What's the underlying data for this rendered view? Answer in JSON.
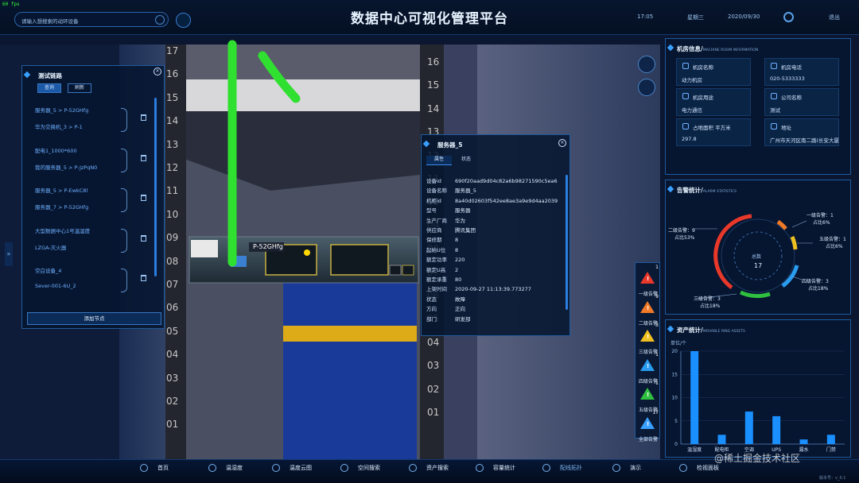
{
  "fps": "60 fps",
  "header": {
    "search_placeholder": "请输入想搜索的动环设备",
    "title": "数据中心可视化管理平台",
    "time": "17:05",
    "weekday": "星期三",
    "date": "2020/09/30",
    "exit": "退出"
  },
  "test_panel": {
    "title": "测试链路",
    "tab_query": "查询",
    "tab_refresh": "刷新",
    "groups": [
      {
        "a": "服务器_5 > P-52GHfg",
        "b": "华为交换机_3 > P-1"
      },
      {
        "a": "配电1_1000*600",
        "b": "我的服务器_5 > P-JzPqN0"
      },
      {
        "a": "服务器_5 > P-EwkC8l",
        "b": "服务器_7 > P-52GHfg"
      },
      {
        "a": "大型数据中心1号温湿度",
        "b": "LZGA-灭火器"
      },
      {
        "a": "空白设备_4",
        "b": "Sever-001-6U_2"
      }
    ],
    "add_button": "添加节点"
  },
  "rack": {
    "left_units": [
      "17",
      "16",
      "15",
      "14",
      "13",
      "12",
      "11",
      "10",
      "09",
      "08",
      "07",
      "06",
      "05",
      "04",
      "03",
      "02",
      "01"
    ],
    "right_units": [
      "16",
      "15",
      "14",
      "13",
      "12",
      "11",
      "10",
      "09",
      "08",
      "07",
      "06",
      "05",
      "04",
      "03",
      "02",
      "01"
    ],
    "port_label": "P-52GHfg"
  },
  "server_panel": {
    "title": "服务器_5",
    "tab_props": "属性",
    "tab_status": "状态",
    "rows": [
      {
        "k": "设备id",
        "v": "690f20aad9d04c82a6b98271590c5ea6"
      },
      {
        "k": "设备名称",
        "v": "服务器_5"
      },
      {
        "k": "机柜id",
        "v": "8a40d02603f542ee8ae3a9e9d4aa2039"
      },
      {
        "k": "型号",
        "v": "服务器"
      },
      {
        "k": "生产厂商",
        "v": "华为"
      },
      {
        "k": "供应商",
        "v": "腾讯集团"
      },
      {
        "k": "保修期",
        "v": "8"
      },
      {
        "k": "起始U位",
        "v": "8"
      },
      {
        "k": "额定功率",
        "v": "220"
      },
      {
        "k": "额定U高",
        "v": "2"
      },
      {
        "k": "额定承重",
        "v": "80"
      },
      {
        "k": "上架时间",
        "v": "2020-09-27 11:13:39.773277"
      },
      {
        "k": "状态",
        "v": "故障"
      },
      {
        "k": "方向",
        "v": "正向"
      },
      {
        "k": "部门",
        "v": "研发部"
      }
    ]
  },
  "alarm_sidebar": [
    {
      "level": "一级告警",
      "count": "1",
      "color": "#e8382a"
    },
    {
      "level": "二级告警",
      "count": "9",
      "color": "#f07a28"
    },
    {
      "level": "三级告警",
      "count": "3",
      "color": "#f0c020"
    },
    {
      "level": "四级告警",
      "count": "1",
      "color": "#2a9cf0"
    },
    {
      "level": "五级告警",
      "count": "1",
      "color": "#30c040"
    },
    {
      "level": "全部告警",
      "count": "17",
      "color": "#3aa0ff"
    }
  ],
  "room_info": {
    "title": "机房信息/",
    "subtitle": "MACHINE ROOM INFORMATION",
    "fields": [
      {
        "k": "机房名称",
        "v": "动力机房"
      },
      {
        "k": "机房电话",
        "v": "020-5333333"
      },
      {
        "k": "机房用途",
        "v": "电力通信"
      },
      {
        "k": "公司名称",
        "v": "测试"
      },
      {
        "k": "占地面积 平方米",
        "v": "297.8"
      },
      {
        "k": "地址",
        "v": "广州市天河区南二路(长安大厦"
      }
    ]
  },
  "alarm_stats": {
    "title": "告警统计/",
    "subtitle": "ALARM STATISTICS",
    "total_label": "总数",
    "total": "17",
    "labels": [
      {
        "name": "一级告警：1",
        "pct": "占比6%"
      },
      {
        "name": "二级告警：9",
        "pct": "占比53%"
      },
      {
        "name": "五级告警：1",
        "pct": "占比6%"
      },
      {
        "name": "四级告警：3",
        "pct": "占比18%"
      },
      {
        "name": "三级告警：3",
        "pct": "占比18%"
      }
    ]
  },
  "asset_stats": {
    "title": "资产统计/",
    "subtitle": "MOVABLE RING ASSETS",
    "unit": "单位/个"
  },
  "chart_data": {
    "type": "bar",
    "categories": [
      "温湿度",
      "配电柜",
      "空调",
      "UPS",
      "漏水",
      "门禁"
    ],
    "values": [
      20,
      2,
      7,
      6,
      1,
      2
    ],
    "ylim": [
      0,
      20
    ],
    "yticks": [
      "0",
      "5",
      "10",
      "15",
      "20"
    ],
    "color": "#1a8fff"
  },
  "bottom_nav": [
    "首页",
    "温湿度",
    "温度云图",
    "空间搜索",
    "资产搜索",
    "容量统计",
    "配线拓扑",
    "演示",
    "检视面板"
  ],
  "version": "版本号：v_0.1",
  "watermark": "@稀土掘金技术社区"
}
